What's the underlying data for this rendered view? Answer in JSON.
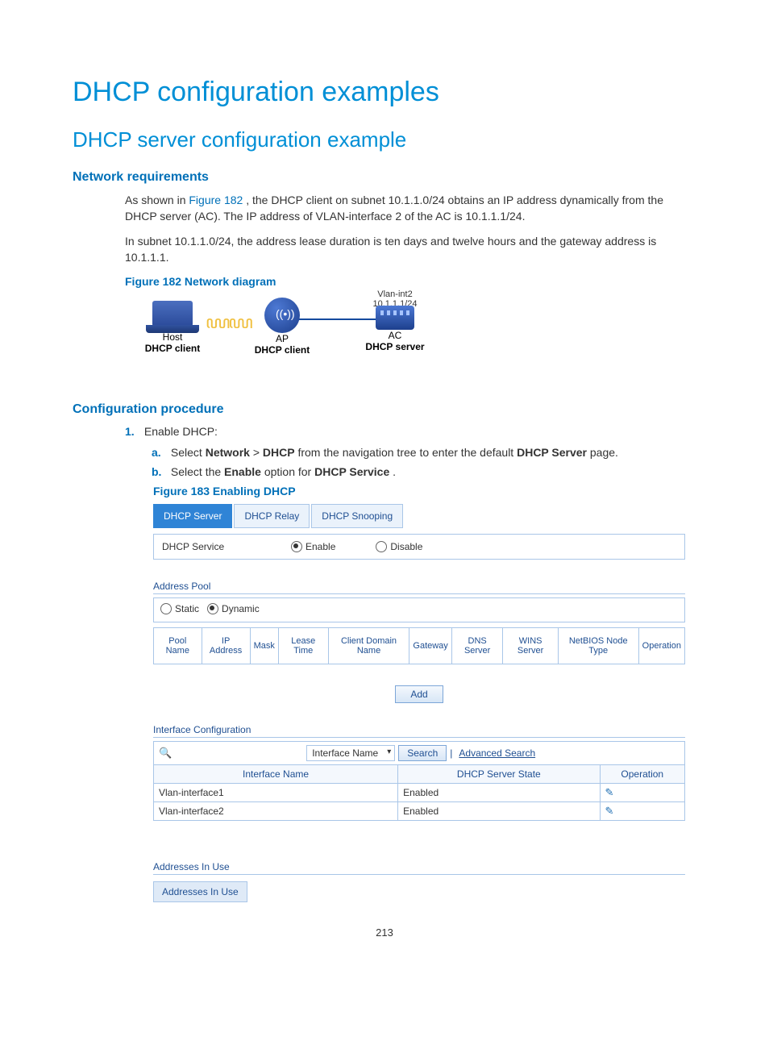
{
  "title": "DHCP configuration examples",
  "subtitle": "DHCP server configuration example",
  "netreq_heading": "Network requirements",
  "netreq_p1_pre": "As shown in ",
  "netreq_p1_ref": "Figure 182",
  "netreq_p1_post": ", the DHCP client on subnet 10.1.1.0/24 obtains an IP address dynamically from the DHCP server (AC). The IP address of VLAN-interface 2 of the AC is 10.1.1.1/24.",
  "netreq_p2": "In subnet 10.1.1.0/24, the address lease duration is ten days and twelve hours and the gateway address is 10.1.1.1.",
  "fig182_cap": "Figure 182 Network diagram",
  "diagram": {
    "host_top": "Host",
    "host_bot": "DHCP client",
    "ap_top": "AP",
    "ap_bot": "DHCP client",
    "ac_top": "AC",
    "ac_bot": "DHCP server",
    "link_l1": "Vlan-int2",
    "link_l2": "10.1.1.1/24"
  },
  "confproc_heading": "Configuration procedure",
  "proc": {
    "n1": "1.",
    "n1_text": "Enable DHCP:",
    "a": "a.",
    "a_pre": "Select ",
    "a_nav1": "Network",
    "a_gt": " > ",
    "a_nav2": "DHCP",
    "a_mid": " from the navigation tree to enter the default ",
    "a_bold": "DHCP Server",
    "a_post": " page.",
    "b": "b.",
    "b_pre": "Select the ",
    "b_b1": "Enable",
    "b_mid": " option for ",
    "b_b2": "DHCP Service",
    "b_post": "."
  },
  "fig183_cap": "Figure 183 Enabling DHCP",
  "ui": {
    "tabs": {
      "server": "DHCP Server",
      "relay": "DHCP Relay",
      "snooping": "DHCP Snooping"
    },
    "svc_label": "DHCP Service",
    "svc_enable": "Enable",
    "svc_disable": "Disable",
    "pool_hdr": "Address Pool",
    "pool_static": "Static",
    "pool_dynamic": "Dynamic",
    "cols": {
      "pool": "Pool Name",
      "ip": "IP Address",
      "mask": "Mask",
      "lease": "Lease Time",
      "domain": "Client Domain Name",
      "gw": "Gateway",
      "dns": "DNS Server",
      "wins": "WINS Server",
      "nb": "NetBIOS Node Type",
      "op": "Operation"
    },
    "add_btn": "Add",
    "ifcfg_hdr": "Interface Configuration",
    "search_field": "Interface Name",
    "search_btn": "Search",
    "advanced": "Advanced Search",
    "ifcols": {
      "name": "Interface Name",
      "state": "DHCP Server State",
      "op": "Operation"
    },
    "ifrows": [
      {
        "name": "Vlan-interface1",
        "state": "Enabled"
      },
      {
        "name": "Vlan-interface2",
        "state": "Enabled"
      }
    ],
    "inuse_hdr": "Addresses In Use",
    "inuse_tab": "Addresses In Use"
  },
  "pagenum": "213"
}
